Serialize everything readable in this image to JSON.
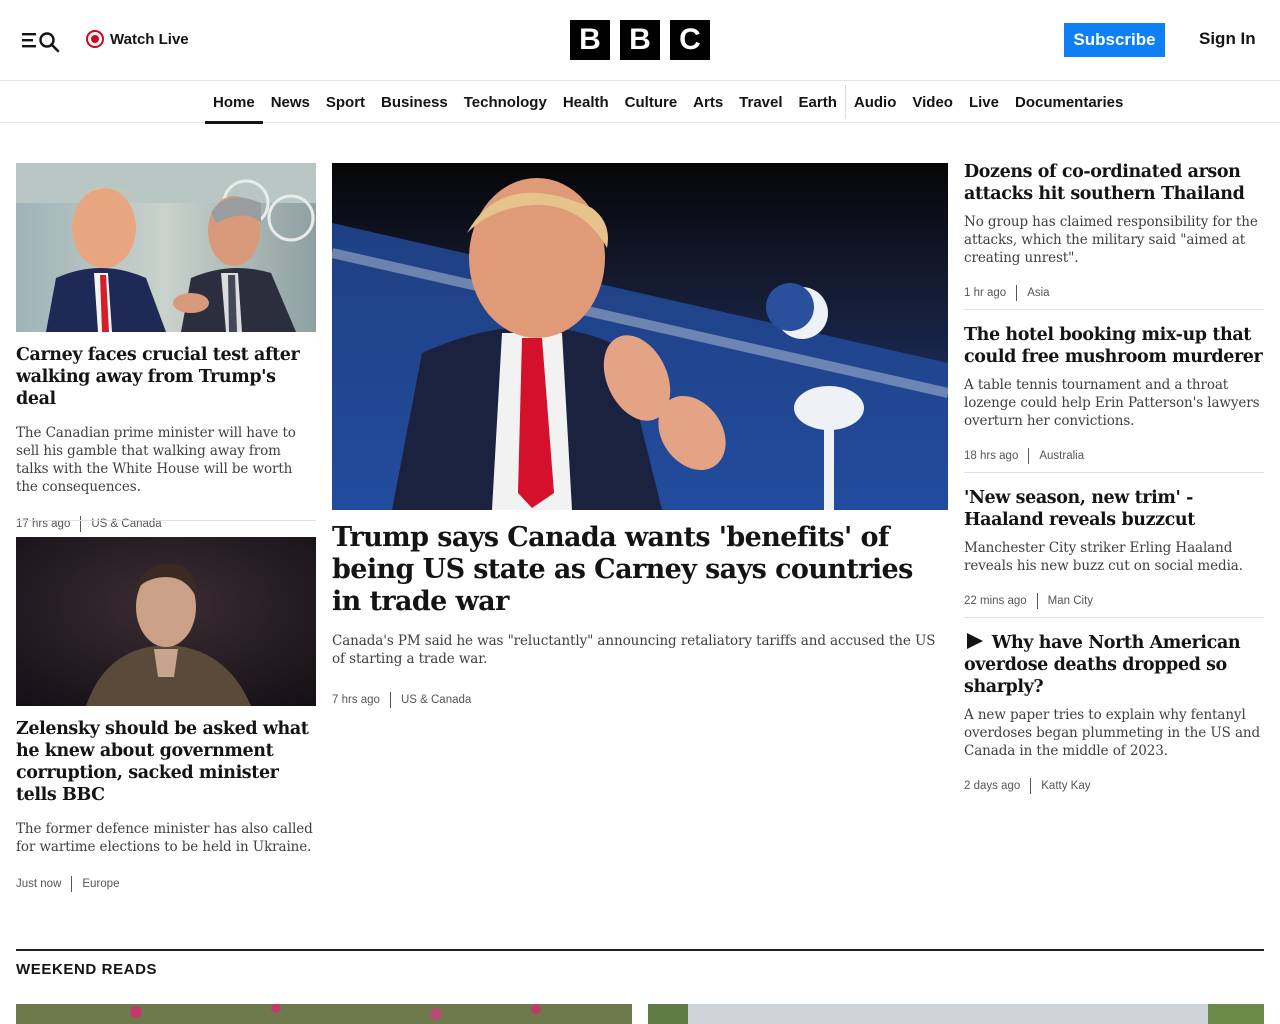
{
  "header": {
    "watch_live": "Watch Live",
    "logo_letters": [
      "B",
      "B",
      "C"
    ],
    "subscribe": "Subscribe",
    "sign_in": "Sign In",
    "accent_color": "#0e7ff5",
    "live_color": "#d4041c"
  },
  "nav": {
    "items": [
      "Home",
      "News",
      "Sport",
      "Business",
      "Technology",
      "Health",
      "Culture",
      "Arts",
      "Travel",
      "Earth",
      "Audio",
      "Video",
      "Live",
      "Documentaries"
    ],
    "active": "Home"
  },
  "stories": {
    "left1": {
      "headline": "Carney faces crucial test after walking away from Trump's deal",
      "summary": "The Canadian prime minister will have to sell his gamble that walking away from talks with the White House will be worth the consequences.",
      "time": "17 hrs ago",
      "tag": "US & Canada"
    },
    "left2": {
      "headline": "Zelensky should be asked what he knew about government corruption, sacked minister tells BBC",
      "summary": "The former defence minister has also called for wartime elections to be held in Ukraine.",
      "time": "Just now",
      "tag": "Europe"
    },
    "main": {
      "headline": "Trump says Canada wants 'benefits' of being US state as Carney says countries in trade war",
      "summary": "Canada's PM said he was \"reluctantly\" announcing retaliatory tariffs and accused the US of starting a trade war.",
      "time": "7 hrs ago",
      "tag": "US & Canada"
    },
    "right1": {
      "headline": "Dozens of co-ordinated arson attacks hit southern Thailand",
      "summary": "No group has claimed responsibility for the attacks, which the military said \"aimed at creating unrest\".",
      "time": "1 hr ago",
      "tag": "Asia"
    },
    "right2": {
      "headline": "The hotel booking mix-up that could free mushroom murderer",
      "summary": "A table tennis tournament and a throat lozenge could help Erin Patterson's lawyers overturn her convictions.",
      "time": "18 hrs ago",
      "tag": "Australia"
    },
    "right3": {
      "headline": "'New season, new trim' - Haaland reveals buzzcut",
      "summary": "Manchester City striker Erling Haaland reveals his new buzz cut on social media.",
      "time": "22 mins ago",
      "tag": "Man City"
    },
    "right4": {
      "headline": "Why have North American overdose deaths dropped so sharply?",
      "summary": "A new paper tries to explain why fentanyl overdoses began plummeting in the US and Canada in the middle of 2023.",
      "time": "2 days ago",
      "tag": "Katty Kay",
      "icon": "play-icon"
    }
  },
  "weekend_reads": {
    "title": "WEEKEND READS"
  }
}
